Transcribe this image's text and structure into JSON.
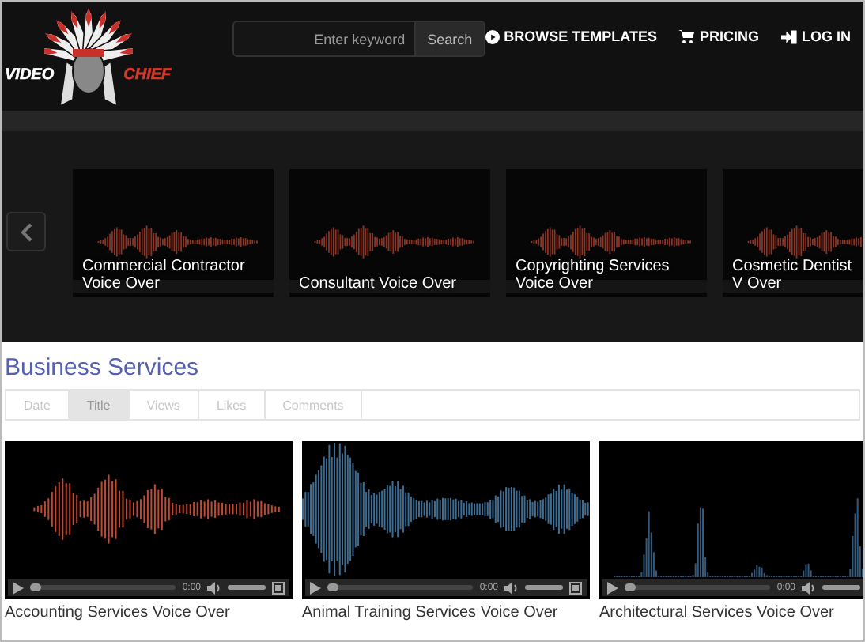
{
  "logo": {
    "left_word": "VIDEO",
    "right_word": "CHIEF"
  },
  "search": {
    "placeholder": "Enter keyword",
    "button": "Search"
  },
  "nav": [
    {
      "label": "BROWSE TEMPLATES"
    },
    {
      "label": "PRICING"
    },
    {
      "label": "LOG IN"
    }
  ],
  "carousel": {
    "items": [
      {
        "title": "Commercial Contractor Voice Over"
      },
      {
        "title": "Consultant Voice Over"
      },
      {
        "title": "Copyrighting Services Voice Over"
      },
      {
        "title": "Cosmetic Dentist V Over"
      }
    ]
  },
  "section": {
    "title": "Business Services"
  },
  "sort_tabs": [
    {
      "label": "Date",
      "selected": false
    },
    {
      "label": "Title",
      "selected": true
    },
    {
      "label": "Views",
      "selected": false
    },
    {
      "label": "Likes",
      "selected": false
    },
    {
      "label": "Comments",
      "selected": false
    }
  ],
  "videos": [
    {
      "kind": "speech",
      "time": "0:00",
      "seek": {
        "level": 0
      },
      "volume": {
        "level": 1
      },
      "title": "Accounting Services Voice Over"
    },
    {
      "kind": "dense",
      "time": "0:00",
      "seek": {
        "level": 0
      },
      "volume": {
        "level": 1
      },
      "title": "Animal Training Services Voice Over"
    },
    {
      "kind": "peaks",
      "time": "0:00",
      "seek": {
        "level": 0
      },
      "volume": {
        "level": 1
      },
      "title": "Architectural Services Voice Over"
    }
  ]
}
